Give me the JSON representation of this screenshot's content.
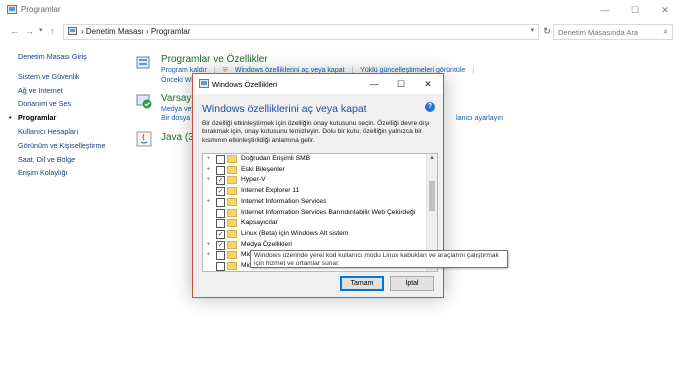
{
  "window": {
    "title": "Programlar",
    "controls": {
      "minimize": "—",
      "maximize": "☐",
      "close": "✕"
    }
  },
  "address": {
    "breadcrumbs": [
      "Denetim Masası",
      "Programlar"
    ],
    "search_placeholder": "Denetim Masasında Ara"
  },
  "sidebar": {
    "items": [
      {
        "label": "Denetim Masası Giriş"
      },
      {
        "label": "Sistem ve Güvenlik"
      },
      {
        "label": "Ağ ve Internet"
      },
      {
        "label": "Donanım ve Ses"
      },
      {
        "label": "Programlar"
      },
      {
        "label": "Kullanıcı Hesapları"
      },
      {
        "label": "Görünüm ve Kişiselleştirme"
      },
      {
        "label": "Saat, Dil ve Bölge"
      },
      {
        "label": "Erişim Kolaylığı"
      }
    ]
  },
  "categories": {
    "programs": {
      "title": "Programlar ve Özellikler",
      "links": [
        "Program kaldır",
        "Windows özelliklerini aç veya kapat",
        "Yüklü güncelleştirmeleri görüntüle"
      ],
      "partial_link": "Önceki Wi"
    },
    "defaults": {
      "title": "Varsayıl",
      "links": [
        "Medya veya",
        "Bir dosya t"
      ],
      "right_link": "lanıcı ayarlayın"
    },
    "java": {
      "title": "Java (32"
    }
  },
  "dialog": {
    "title": "Windows Özellikleri",
    "heading": "Windows özelliklerini aç veya kapat",
    "description": "Bir özelliği etkinleştirmek için özelliğin onay kutusunu seçin. Özelliği devre dışı bırakmak için, onay kutusunu temizleyin. Dolu bir kutu, özelliğin yalnızca bir kısmının etkinleştirildiği anlamına gelir.",
    "features": [
      {
        "label": "Doğrudan Erişimli SMB",
        "expand": "+",
        "state": "unchecked"
      },
      {
        "label": "Eski Bileşenler",
        "expand": "+",
        "state": "unchecked"
      },
      {
        "label": "Hyper-V",
        "expand": "+",
        "state": "checked"
      },
      {
        "label": "Internet Explorer 11",
        "expand": "",
        "state": "checked"
      },
      {
        "label": "Internet Information Services",
        "expand": "+",
        "state": "unchecked"
      },
      {
        "label": "Internet Information Services Barındırılabilir Web Çekirdeği",
        "expand": "",
        "state": "unchecked"
      },
      {
        "label": "Kapsayıcılar",
        "expand": "",
        "state": "unchecked"
      },
      {
        "label": "Linux (Beta) için Windows Alt sistem",
        "expand": "",
        "state": "checked"
      },
      {
        "label": "Medya Özellikleri",
        "expand": "+",
        "state": "checked"
      },
      {
        "label": "Microsoft Me",
        "expand": "+",
        "state": "unchecked"
      },
      {
        "label": "Microsoft PD",
        "expand": "",
        "state": "unchecked"
      }
    ],
    "tooltip": "Windows üzerinde yerel kod kullanıcı modu Linux kabukları ve araçlarını çalıştırmak için hizmet ve ortamlar sunar.",
    "ok_label": "Tamam",
    "cancel_label": "İptal"
  }
}
